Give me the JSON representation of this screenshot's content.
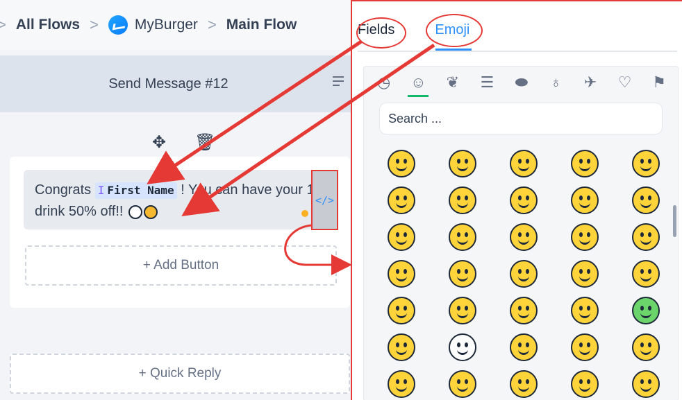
{
  "breadcrumb": {
    "items": [
      "All Flows",
      "MyBurger",
      "Main Flow"
    ],
    "separator": ">"
  },
  "node": {
    "title": "Send Message #12",
    "message_before": "Congrats ",
    "field_tag": "First Name",
    "message_after": "! You can have your 1st drink 50% off!!",
    "add_button": "+ Add Button",
    "quick_reply": "+ Quick Reply",
    "code_toggle": "</>"
  },
  "panel": {
    "tabs": [
      "Fields",
      "Emoji"
    ],
    "active_tab": "Emoji",
    "search_placeholder": "Search ...",
    "categories": [
      "clock-icon",
      "smiley-icon",
      "leaf-icon",
      "burger-icon",
      "football-icon",
      "bulb-icon",
      "plane-icon",
      "heart-icon",
      "flag-icon"
    ],
    "emoji_rows": 7,
    "emoji_cols": 5
  },
  "colors": {
    "accent": "#2e90fa",
    "annotation_red": "#e53935",
    "emoji_yellow": "#ffd33a"
  }
}
